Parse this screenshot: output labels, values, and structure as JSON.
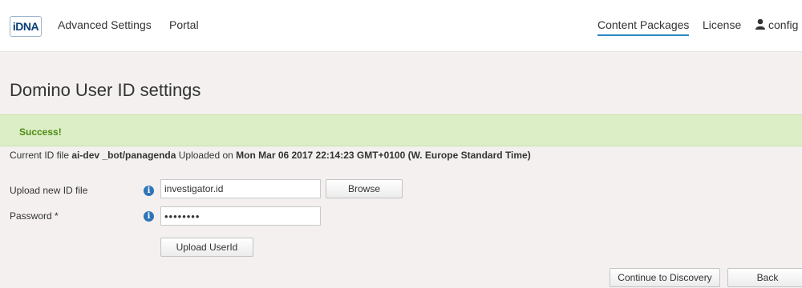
{
  "header": {
    "logo_text": "iDNA",
    "nav_left": [
      "Advanced Settings",
      "Portal"
    ],
    "nav_right": {
      "content_packages": "Content Packages",
      "license": "License",
      "user": "config"
    }
  },
  "page": {
    "title": "Domino User ID settings"
  },
  "alert": {
    "text": "Success!",
    "color": "#dbeec6"
  },
  "current_id": {
    "label": "Current ID file",
    "file": "ai-dev _bot/panagenda",
    "uploaded_label": "Uploaded on",
    "date": "Mon Mar 06 2017 22:14:23 GMT+0100 (W. Europe Standard Time)"
  },
  "form": {
    "upload_label": "Upload new ID file",
    "upload_value": "investigator.id",
    "browse_label": "Browse",
    "password_label": "Password *",
    "password_value": "••••••••",
    "upload_button": "Upload UserId",
    "info_icon": "i"
  },
  "footer_buttons": {
    "continue": "Continue to Discovery",
    "back": "Back"
  },
  "colors": {
    "accent": "#2e87c8",
    "success_text": "#4f8a10"
  }
}
